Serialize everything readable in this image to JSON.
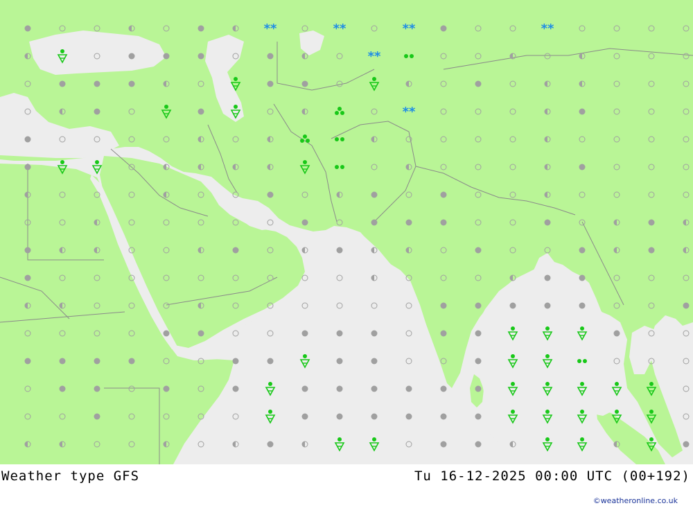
{
  "map": {
    "title": "Weather type   GFS",
    "valid_time": "Tu 16-12-2025 00:00 UTC (00+192)",
    "credit": "©weatheronline.co.uk",
    "colors": {
      "land": "#b9f596",
      "sea": "#ededed",
      "border": "#8a8a8a",
      "symbol_cloud": "#a0a0a0",
      "symbol_rain": "#18c818",
      "symbol_snow": "#1e8ce6"
    },
    "grid_symbols": [
      "f o o h o f h o o o o o f o o f o o o o",
      "h o o f f f o f h o o f o o h o h o o o",
      "o f f f h o f f f o o h o f o h h o o o",
      "o h f o f f f o h f o o o o o h f o o o",
      "f o o o o h o h o o h o o o o h o o o o",
      "f f f o h h h h o o o h o o o h f o o o",
      "h o o o h o o f o h f o f o o h o o o o",
      "o o h o o o o o f o f f f o o f o h f h",
      "f h h o o h f o h f h h o f o o f h f h",
      "f o o o o o o o o o h o o o h f f o o o",
      "h h o o o h o o o o o o f f f f f o o f",
      "o o o o f f o o f f f o f f o f f f o o",
      "f f f f o o f f f f f o o f o f o o o o",
      "o f f o f o f f f f f f f f f o f f f o",
      "o o f o o o o f f f f f f f o o f o o o",
      "h h o o h o h f h h o o f f h o h h h f"
    ],
    "symbol_legend": {
      "f": "overcast-cloud",
      "h": "partly-cloudy",
      "o": "clear-sky"
    },
    "weather_symbols": [
      {
        "type": "snow",
        "col": 7,
        "row": 0
      },
      {
        "type": "snow",
        "col": 9,
        "row": 0
      },
      {
        "type": "snow",
        "col": 11,
        "row": 0
      },
      {
        "type": "snow",
        "col": 15,
        "row": 0
      },
      {
        "type": "rain-shower",
        "col": 1,
        "row": 1
      },
      {
        "type": "snow",
        "col": 10,
        "row": 1
      },
      {
        "type": "rain",
        "col": 11,
        "row": 1
      },
      {
        "type": "rain-shower",
        "col": 6,
        "row": 2
      },
      {
        "type": "rain-shower",
        "col": 10,
        "row": 2
      },
      {
        "type": "rain-shower",
        "col": 4,
        "row": 3
      },
      {
        "type": "rain-shower",
        "col": 6,
        "row": 3
      },
      {
        "type": "heavy-rain",
        "col": 9,
        "row": 3
      },
      {
        "type": "snow",
        "col": 11,
        "row": 3
      },
      {
        "type": "heavy-rain",
        "col": 8,
        "row": 4
      },
      {
        "type": "rain",
        "col": 9,
        "row": 4
      },
      {
        "type": "rain-shower",
        "col": 1,
        "row": 5
      },
      {
        "type": "rain-shower",
        "col": 2,
        "row": 5
      },
      {
        "type": "rain-shower",
        "col": 8,
        "row": 5
      },
      {
        "type": "rain",
        "col": 9,
        "row": 5
      },
      {
        "type": "rain-shower",
        "col": 14,
        "row": 11
      },
      {
        "type": "rain-shower",
        "col": 15,
        "row": 11
      },
      {
        "type": "rain-shower",
        "col": 16,
        "row": 11
      },
      {
        "type": "rain-shower",
        "col": 8,
        "row": 12
      },
      {
        "type": "rain-shower",
        "col": 14,
        "row": 12
      },
      {
        "type": "rain-shower",
        "col": 15,
        "row": 12
      },
      {
        "type": "rain",
        "col": 16,
        "row": 12
      },
      {
        "type": "rain-shower",
        "col": 7,
        "row": 13
      },
      {
        "type": "rain-shower",
        "col": 14,
        "row": 13
      },
      {
        "type": "rain-shower",
        "col": 15,
        "row": 13
      },
      {
        "type": "rain-shower",
        "col": 16,
        "row": 13
      },
      {
        "type": "rain-shower",
        "col": 17,
        "row": 13
      },
      {
        "type": "rain-shower",
        "col": 18,
        "row": 13
      },
      {
        "type": "rain-shower",
        "col": 7,
        "row": 14
      },
      {
        "type": "rain-shower",
        "col": 14,
        "row": 14
      },
      {
        "type": "rain-shower",
        "col": 15,
        "row": 14
      },
      {
        "type": "rain-shower",
        "col": 16,
        "row": 14
      },
      {
        "type": "rain-shower",
        "col": 17,
        "row": 14
      },
      {
        "type": "rain-shower",
        "col": 18,
        "row": 14
      },
      {
        "type": "rain-shower",
        "col": 9,
        "row": 15
      },
      {
        "type": "rain-shower",
        "col": 10,
        "row": 15
      },
      {
        "type": "rain-shower",
        "col": 15,
        "row": 15
      },
      {
        "type": "rain-shower",
        "col": 16,
        "row": 15
      },
      {
        "type": "rain-shower",
        "col": 18,
        "row": 15
      }
    ]
  }
}
